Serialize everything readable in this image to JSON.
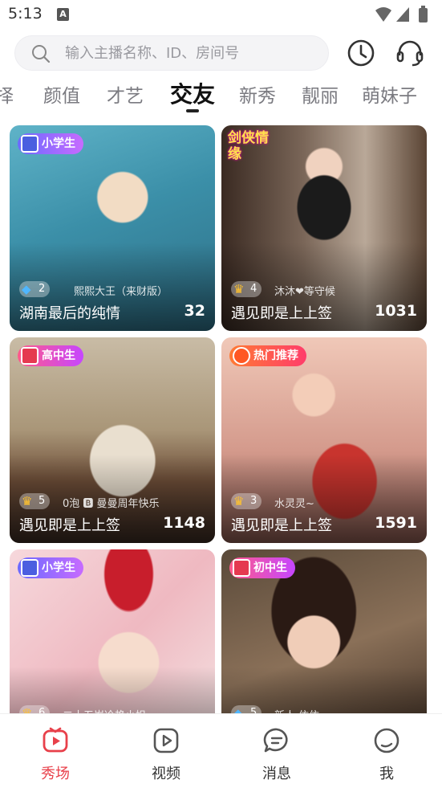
{
  "status_bar": {
    "time": "5:13",
    "sim_label": "A"
  },
  "search": {
    "placeholder": "输入主播名称、ID、房间号"
  },
  "header_icons": {
    "history": "clock-icon",
    "service": "headset-icon"
  },
  "tabs": [
    {
      "label": "择"
    },
    {
      "label": "颜值"
    },
    {
      "label": "才艺"
    },
    {
      "label": "交友",
      "active": true
    },
    {
      "label": "新秀"
    },
    {
      "label": "靓丽"
    },
    {
      "label": "萌妹子"
    }
  ],
  "cards": [
    {
      "badge": "小学生",
      "badge_style": "blue",
      "level_type": "diamond",
      "level": "2",
      "host": "熙熙大王（来财版）",
      "title": "湖南最后的纯情",
      "viewers": "32"
    },
    {
      "badge": "剑侠情缘",
      "badge_style": "tag",
      "level_type": "crown",
      "level": "4",
      "host": "沐沐❤等守候",
      "title": "遇见即是上上签",
      "viewers": "1031"
    },
    {
      "badge": "高中生",
      "badge_style": "red",
      "level_type": "crown",
      "level": "5",
      "host": "0泡 🅱 曼曼周年快乐",
      "title": "遇见即是上上签",
      "viewers": "1148"
    },
    {
      "badge": "热门推荐",
      "badge_style": "hot",
      "level_type": "crown",
      "level": "3",
      "host": "水灵灵~",
      "title": "遇见即是上上签",
      "viewers": "1591"
    },
    {
      "badge": "小学生",
      "badge_style": "blue",
      "level_type": "crown",
      "level": "6",
      "host": "二十五岁冷艳小姐",
      "title": "",
      "viewers": ""
    },
    {
      "badge": "初中生",
      "badge_style": "red",
      "level_type": "diamond",
      "level": "5",
      "host": "新人 依依",
      "title": "",
      "viewers": ""
    }
  ],
  "bottom_nav": [
    {
      "label": "秀场",
      "icon": "live-stage-icon",
      "active": true
    },
    {
      "label": "视频",
      "icon": "video-play-icon"
    },
    {
      "label": "消息",
      "icon": "message-icon"
    },
    {
      "label": "我",
      "icon": "profile-icon"
    }
  ],
  "colors": {
    "accent": "#e8404a",
    "active_tab": "#111111",
    "inactive_tab": "#7a7a80"
  }
}
